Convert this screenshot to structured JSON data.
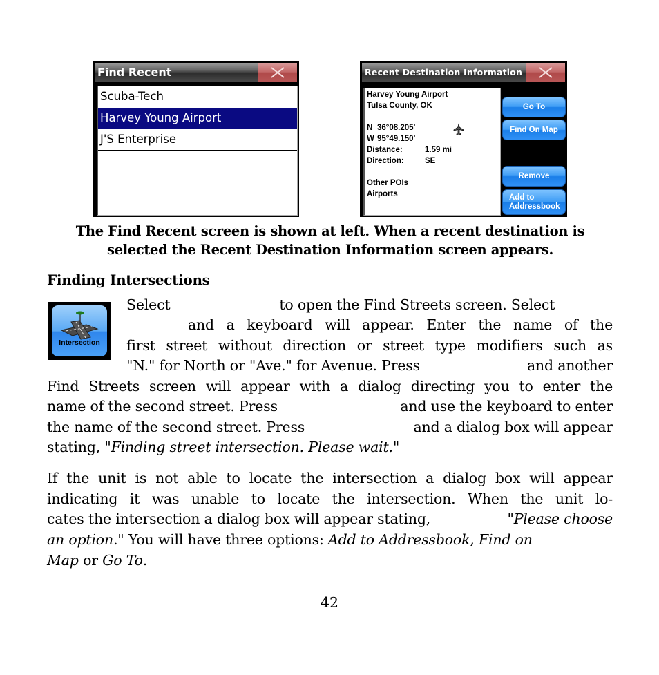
{
  "figure_left": {
    "title": "Find Recent",
    "close_icon": "close-x-icon",
    "items": [
      {
        "label": "Scuba-Tech",
        "selected": false
      },
      {
        "label": "Harvey Young Airport",
        "selected": true
      },
      {
        "label": "J'S Enterprise",
        "selected": false
      }
    ]
  },
  "figure_right": {
    "title": "Recent Destination Information",
    "close_icon": "close-x-icon",
    "name": "Harvey Young Airport",
    "location": "Tulsa County, OK",
    "lat_dir": "N",
    "lat": "36°08.205'",
    "lon_dir": "W",
    "lon": "95°49.150'",
    "distance_label": "Distance:",
    "distance_value": "1.59 mi",
    "direction_label": "Direction:",
    "direction_value": "SE",
    "category": "Other POIs",
    "subcategory": "Airports",
    "poi_icon": "airplane-icon",
    "buttons": {
      "go_to": "Go To",
      "find_on_map": "Find On Map",
      "remove": "Remove",
      "add_line1": "Add to",
      "add_line2": "Addressbook"
    }
  },
  "caption": {
    "line1": "The Find Recent screen is shown at left. When a recent destination is",
    "line2": "selected the Recent Destination Information screen appears."
  },
  "section": {
    "heading": "Finding Intersections",
    "icon_label": "Intersection",
    "para1": {
      "l1a": "Select",
      "l1b": "to open the Find Streets screen. Select",
      "l2": "and a keyboard will appear. Enter the name of the",
      "l3": "first street without direction or street type modifiers such as",
      "l4a": "\"N.\" for North or \"Ave.\" for Avenue. Press",
      "l4b": "and another",
      "l5": "Find Streets screen will appear with a dialog directing you to enter the",
      "l6a": "name of the second street. Press",
      "l6b": "and use the keyboard to enter",
      "l7a": "the name of the second street. Press",
      "l7b": "and a dialog box will appear",
      "l8a": "stating, ",
      "l8b": "\"Finding street intersection. Please wait.\""
    },
    "para2": {
      "l1": "If the unit is not able to locate the intersection a dialog box will appear",
      "l2": "indicating it was unable to locate the intersection. When the unit lo-",
      "l3a": "cates the intersection a dialog box will appear stating, ",
      "l3b": "\"Please choose",
      "l4a": "an option.\"",
      "l4b": " You will have three options: ",
      "l4c": "Add to Addressbook",
      "l4d": ", ",
      "l4e": "Find on",
      "l5a": "Map",
      "l5b": " or ",
      "l5c": "Go To",
      "l5d": "."
    }
  },
  "page_number": "42"
}
